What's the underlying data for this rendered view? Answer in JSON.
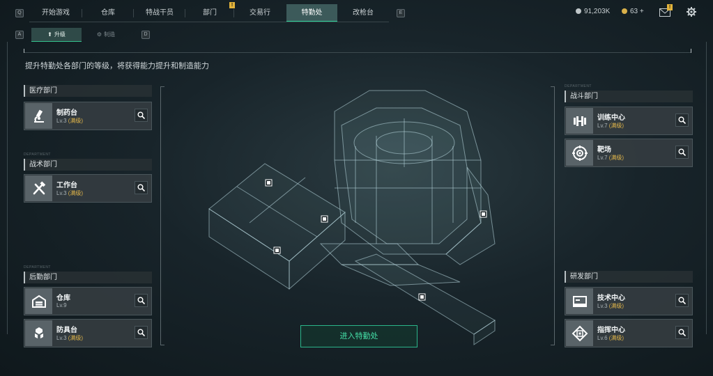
{
  "topbar": {
    "left_key": "Q",
    "right_key": "E",
    "tabs": [
      {
        "label": "开始游戏",
        "active": false
      },
      {
        "label": "仓库",
        "active": false
      },
      {
        "label": "特战干员",
        "active": false
      },
      {
        "label": "部门",
        "active": false,
        "badge": "!"
      },
      {
        "label": "交易行",
        "active": false
      },
      {
        "label": "特勤处",
        "active": true
      },
      {
        "label": "改枪台",
        "active": false
      }
    ],
    "currency1": "91,203K",
    "currency2": "63 +",
    "mail_badge": "!"
  },
  "subtabs": {
    "left_key": "A",
    "right_key": "D",
    "upgrade": "升级",
    "craft": "制造"
  },
  "description": "提升特勤处各部门的等级，将获得能力提升和制造能力",
  "left": {
    "medical": {
      "title": "医疗部门",
      "cards": [
        {
          "name": "制药台",
          "level": "Lv.3",
          "max": "(满级)"
        }
      ]
    },
    "tactical": {
      "title": "战术部门",
      "tag": "DEPARTMENT",
      "cards": [
        {
          "name": "工作台",
          "level": "Lv.3",
          "max": "(满级)"
        }
      ]
    },
    "logistics": {
      "title": "后勤部门",
      "tag": "DEPARTMENT",
      "cards": [
        {
          "name": "仓库",
          "level": "Lv.9",
          "max": ""
        },
        {
          "name": "防具台",
          "level": "Lv.3",
          "max": "(满级)"
        }
      ]
    }
  },
  "right": {
    "combat": {
      "title": "战斗部门",
      "tag": "DEPARTMENT",
      "cards": [
        {
          "name": "训练中心",
          "level": "Lv.7",
          "max": "(满级)"
        },
        {
          "name": "靶场",
          "level": "Lv.7",
          "max": "(满级)"
        }
      ]
    },
    "research": {
      "title": "研发部门",
      "cards": [
        {
          "name": "技术中心",
          "level": "Lv.3",
          "max": "(满级)"
        },
        {
          "name": "指挥中心",
          "level": "Lv.6",
          "max": "(满级)"
        }
      ]
    }
  },
  "enter_button": "进入特勤处",
  "colors": {
    "accent": "#2bd39a",
    "max_level": "#e0b54a",
    "badge": "#e2b33b"
  }
}
